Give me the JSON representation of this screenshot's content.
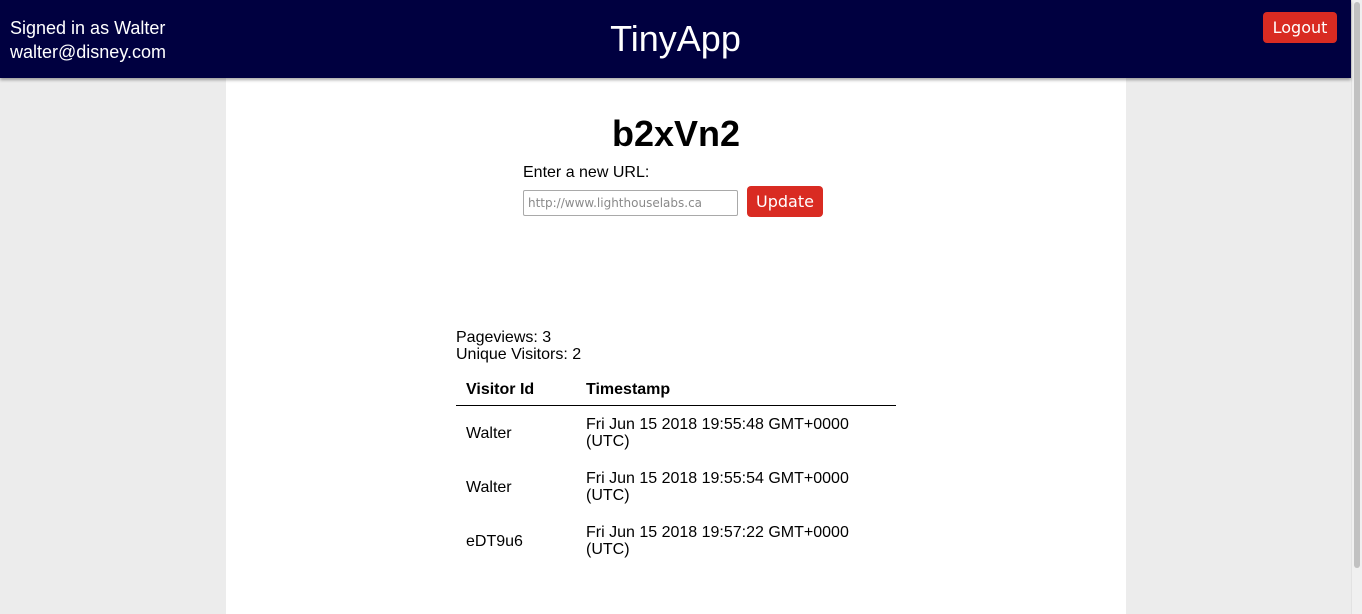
{
  "header": {
    "signed_in_text": "Signed in as Walter",
    "email": "walter@disney.com",
    "app_title": "TinyApp",
    "logout_label": "Logout"
  },
  "main": {
    "short_code": "b2xVn2",
    "url_label": "Enter a new URL:",
    "url_placeholder": "http://www.lighthouselabs.ca",
    "update_label": "Update",
    "pageviews_text": "Pageviews: 3",
    "unique_visitors_text": "Unique Visitors: 2",
    "table": {
      "columns": [
        "Visitor Id",
        "Timestamp"
      ],
      "rows": [
        {
          "visitor_id": "Walter",
          "timestamp": "Fri Jun 15 2018 19:55:48 GMT+0000 (UTC)"
        },
        {
          "visitor_id": "Walter",
          "timestamp": "Fri Jun 15 2018 19:55:54 GMT+0000 (UTC)"
        },
        {
          "visitor_id": "eDT9u6",
          "timestamp": "Fri Jun 15 2018 19:57:22 GMT+0000 (UTC)"
        }
      ]
    }
  },
  "colors": {
    "header_bg": "#000040",
    "button_red": "#d92b22",
    "page_bg": "#ececec",
    "panel_bg": "#ffffff"
  }
}
